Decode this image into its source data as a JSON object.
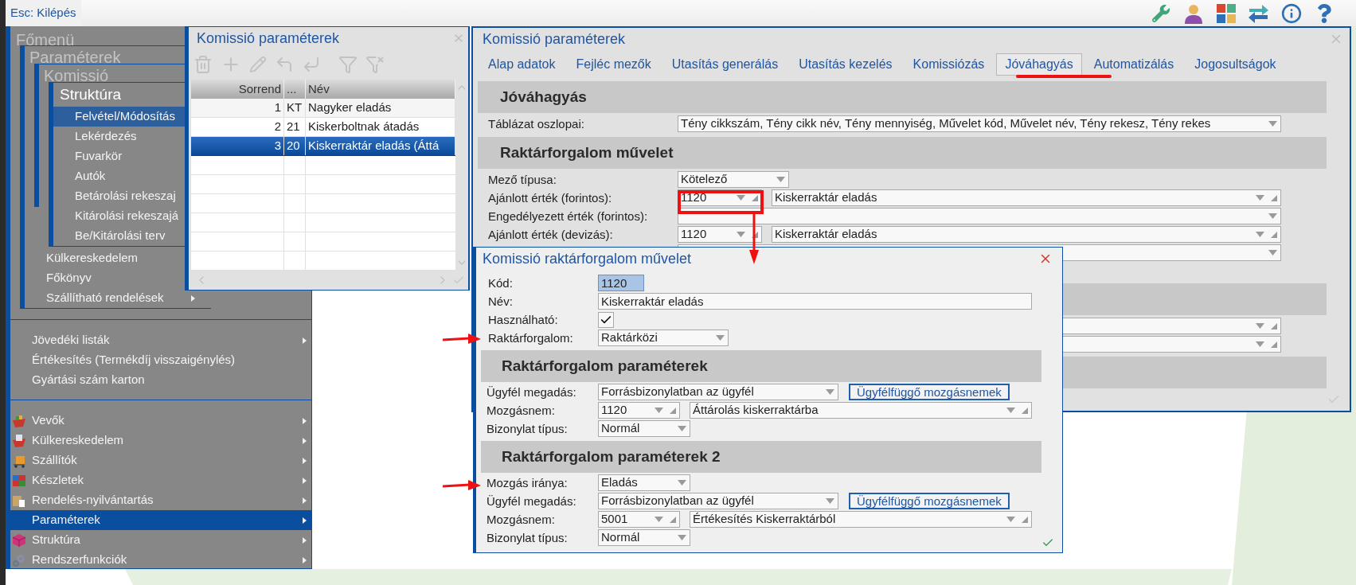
{
  "top_bar": {
    "exit_button": "Esc: Kilépés"
  },
  "main_menu": {
    "title": "Főmenü",
    "parameters_menu": {
      "title": "Paraméterek",
      "items": [
        {
          "label": "Külkereskedelem"
        },
        {
          "label": "Főkönyv"
        },
        {
          "label": "Szállítható rendelések",
          "submenu": true
        }
      ]
    },
    "commission_menu": {
      "title": "Komissió"
    },
    "structure_menu": {
      "title": "Struktúra",
      "items": [
        {
          "label": "Felvétel/Módosítás",
          "selected": true
        },
        {
          "label": "Lekérdezés",
          "selected": false
        },
        {
          "label": "Fuvarkör",
          "selected": false
        },
        {
          "label": "Autók",
          "selected": false
        },
        {
          "label": "Betárolási rekeszaj",
          "selected": false
        },
        {
          "label": "Kitárolási rekeszajá",
          "selected": false
        },
        {
          "label": "Be/Kitárolási terv",
          "selected": false
        }
      ]
    },
    "groups": [
      {
        "items": [
          {
            "label": "Jövedéki listák",
            "submenu": true,
            "selected": false
          },
          {
            "label": "Értékesítés (Termékdíj visszaigénylés)",
            "submenu": false,
            "selected": false
          },
          {
            "label": "Gyártási szám karton",
            "submenu": false,
            "selected": false
          }
        ]
      },
      {
        "items": [
          {
            "label": "Vevők",
            "submenu": true,
            "selected": false
          },
          {
            "label": "Külkereskedelem",
            "submenu": true,
            "selected": false
          },
          {
            "label": "Szállítók",
            "submenu": true,
            "selected": false
          },
          {
            "label": "Készletek",
            "submenu": true,
            "selected": false
          },
          {
            "label": "Rendelés-nyilvántartás",
            "submenu": true,
            "selected": false
          },
          {
            "label": "Paraméterek",
            "submenu": true,
            "selected": true
          },
          {
            "label": "Struktúra",
            "submenu": true,
            "selected": false
          },
          {
            "label": "Rendszerfunkciók",
            "submenu": true,
            "selected": false
          }
        ]
      }
    ]
  },
  "list_window": {
    "title": "Komissió paraméterek",
    "columns": [
      "Sorrend",
      "...",
      "Név"
    ],
    "rows": [
      {
        "cells": [
          "1",
          "KT",
          "Nagyker eladás"
        ],
        "selected": false
      },
      {
        "cells": [
          "2",
          "21",
          "Kiskerboltnak átadás"
        ],
        "selected": false
      },
      {
        "cells": [
          "3",
          "20",
          "Kiskerraktár eladás (Áttá"
        ],
        "selected": true
      }
    ]
  },
  "params_window": {
    "title": "Komissió paraméterek",
    "tabs": [
      {
        "label": "Alap adatok",
        "selected": false
      },
      {
        "label": "Fejléc mezők",
        "selected": false
      },
      {
        "label": "Utasítás generálás",
        "selected": false
      },
      {
        "label": "Utasítás kezelés",
        "selected": false
      },
      {
        "label": "Komissiózás",
        "selected": false
      },
      {
        "label": "Jóváhagyás",
        "selected": true
      },
      {
        "label": "Automatizálás",
        "selected": false
      },
      {
        "label": "Jogosultságok",
        "selected": false
      }
    ],
    "sections": [
      {
        "title": "Jóváhagyás",
        "rows": [
          {
            "kind": "combo",
            "label": "Táblázat oszlopai:",
            "value": "Tény cikkszám, Tény cikk név, Tény mennyiség, Művelet kód, Művelet név, Tény rekesz, Tény rekes"
          }
        ]
      },
      {
        "title": "Raktárforgalom művelet",
        "rows": [
          {
            "kind": "select",
            "label": "Mező típusa:",
            "value": "Kötelező"
          },
          {
            "kind": "lookup",
            "label": "Ajánlott érték (forintos):",
            "code": "1120",
            "value": "Kiskerraktár eladás"
          },
          {
            "kind": "combo",
            "label": "Engedélyezett érték (forintos):"
          },
          {
            "kind": "lookup",
            "label": "Ajánlott érték (devizás):",
            "code": "1120",
            "value": "Kiskerraktár eladás"
          },
          {
            "kind": "combo"
          }
        ]
      },
      {
        "rows": [
          {
            "kind": "lookup"
          },
          {
            "kind": "lookup"
          }
        ]
      }
    ]
  },
  "dialog": {
    "title": "Komissió raktárforgalom művelet",
    "fields": [
      {
        "kind": "code",
        "label": "Kód:",
        "value": "1120"
      },
      {
        "kind": "text",
        "label": "Név:",
        "value": "Kiskerraktár eladás"
      },
      {
        "kind": "checkbox",
        "label": "Használható:",
        "checked": true
      },
      {
        "kind": "select",
        "label": "Raktárforgalom:",
        "value": "Raktárközi"
      }
    ],
    "sections": [
      {
        "title": "Raktárforgalom paraméterek",
        "rows": [
          {
            "kind": "select_button",
            "label": "Ügyfél megadás:",
            "value": "Forrásbizonylatban az ügyfél",
            "button": "Ügyfélfüggő mozgásnemek"
          },
          {
            "kind": "lookup",
            "label": "Mozgásnem:",
            "code": "1120",
            "value": "Áttárolás kiskerraktárba"
          },
          {
            "kind": "select",
            "label": "Bizonylat típus:",
            "value": "Normál"
          }
        ]
      },
      {
        "title": "Raktárforgalom paraméterek 2",
        "rows": [
          {
            "kind": "select",
            "label": "Mozgás iránya:",
            "value": "Eladás"
          },
          {
            "kind": "select_button",
            "label": "Ügyfél megadás:",
            "value": "Forrásbizonylatban az ügyfél",
            "button": "Ügyfélfüggő mozgásnemek"
          },
          {
            "kind": "lookup",
            "label": "Mozgásnem:",
            "code": "5001",
            "value": "Értékesítés Kiskerraktárból"
          },
          {
            "kind": "select",
            "label": "Bizonylat típus:",
            "value": "Normál"
          }
        ]
      }
    ]
  }
}
